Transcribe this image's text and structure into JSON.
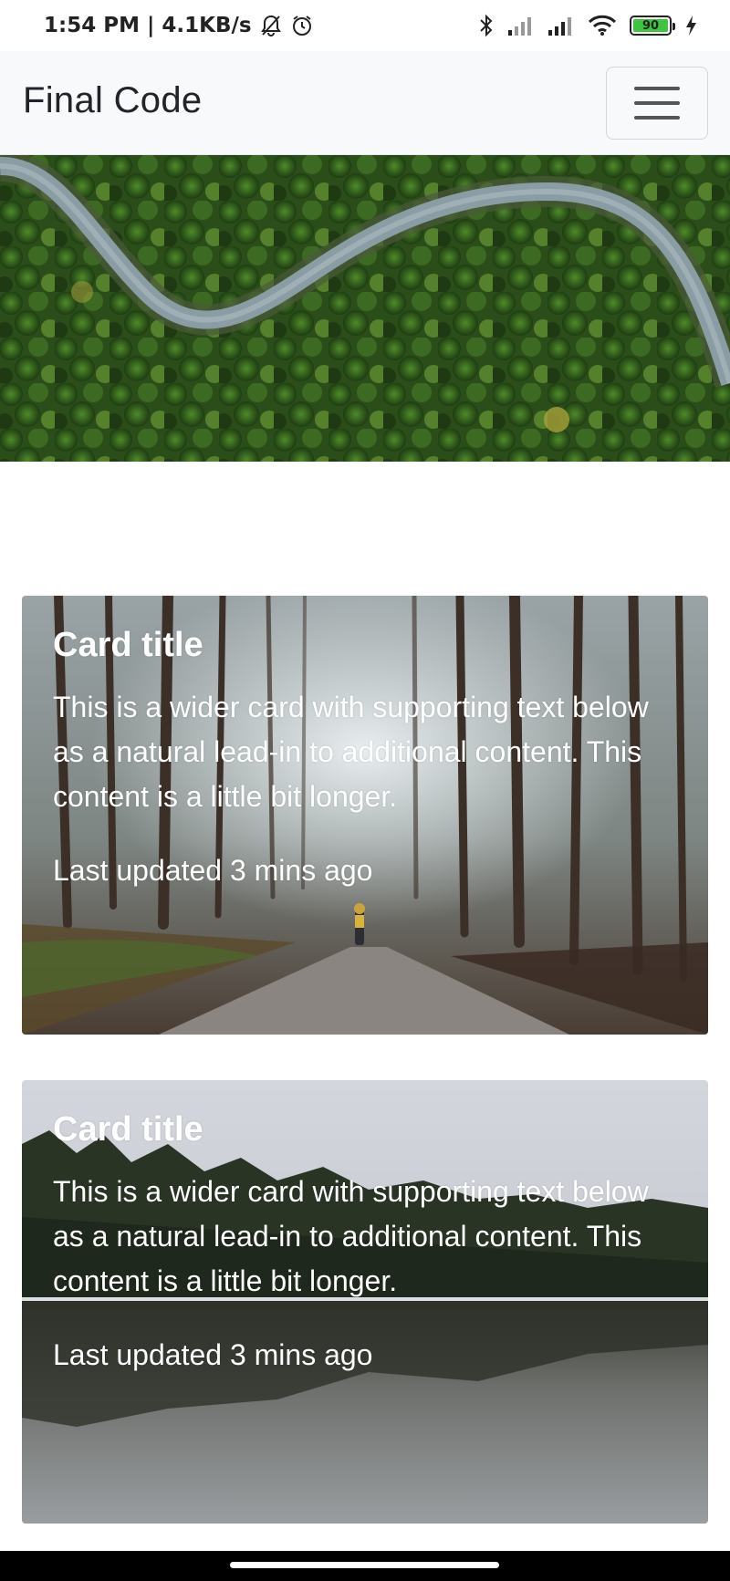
{
  "status_bar": {
    "time": "1:54 PM",
    "separator": "|",
    "network_speed": "4.1KB/s",
    "battery_level": "90",
    "icons": [
      "muted-bell-icon",
      "alarm-icon",
      "bluetooth-icon",
      "signal-icon",
      "signal-icon",
      "wifi-icon",
      "battery-icon",
      "charging-icon"
    ]
  },
  "navbar": {
    "brand": "Final Code",
    "toggler_icon": "hamburger-menu-icon"
  },
  "hero": {
    "image": "aerial-forest-road-image"
  },
  "cards": [
    {
      "image": "foggy-forest-path-image",
      "title": "Card title",
      "text": "This is a wider card with supporting text below as a natural lead-in to additional content. This content is a little bit longer.",
      "updated": "Last updated 3 mins ago"
    },
    {
      "image": "forest-lake-reflection-image",
      "title": "Card title",
      "text": "This is a wider card with supporting text below as a natural lead-in to additional content. This content is a little bit longer.",
      "updated": "Last updated 3 mins ago"
    }
  ],
  "colors": {
    "navbar_bg": "#f8f9fa",
    "brand_text": "#212529",
    "card_text": "#ffffff",
    "battery_fill": "#3ec43e"
  }
}
